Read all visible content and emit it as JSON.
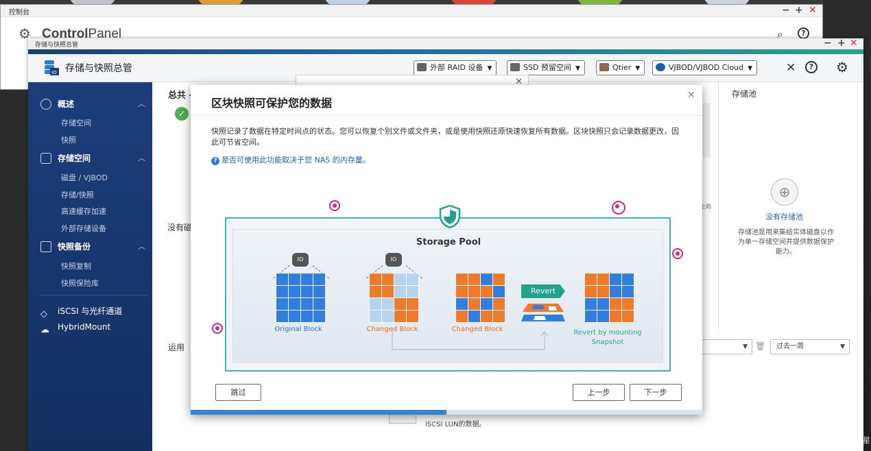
{
  "control_panel": {
    "title_bar": "控制台",
    "app_name_bold": "Control",
    "app_name_rest": "Panel",
    "minimize": "−",
    "maximize": "+",
    "close": "✕"
  },
  "storage_window": {
    "title_bar": "存储与快照总管",
    "app_name": "存储与快照总管",
    "minimize": "−",
    "maximize": "+",
    "close": "✕",
    "toolbar": {
      "external_raid": "外部 RAID 设备",
      "ssd_reserve": "SSD 预留空间",
      "qtier": "Qtier",
      "vjbod": "VJBOD/VJBOD Cloud"
    }
  },
  "sidebar": {
    "overview": {
      "label": "概述",
      "items": [
        "存储空间",
        "快照"
      ]
    },
    "storage": {
      "label": "存储空间",
      "items": [
        "磁盘 / VJBOD",
        "存储/快照",
        "高速缓存加速",
        "外部存储设备"
      ]
    },
    "snapshot_backup": {
      "label": "快照备份",
      "items": [
        "快照复制",
        "快照保险库"
      ]
    },
    "iscsi": "iSCSI 与光纤通道",
    "hybridmount": "HybridMount"
  },
  "main": {
    "total_label": "总共 -",
    "no_disk_label": "没有磁",
    "usage_label": "运用",
    "side_cut_text": "上的",
    "pool_header": "存储池",
    "pool_none": "没有存储池",
    "pool_desc": "存储池是用来集结实体磁盘以作为单一存储空间并提供数据保护能力。",
    "range_select": "过去一周",
    "bottom_text": "iSCSI LUN的数据。"
  },
  "dialog": {
    "title": "区块快照可保护您的数据",
    "description": "快照记录了数据在特定时间点的状态。您可以恢复个别文件或文件夹，或是使用快照还原快速恢复所有数据。区块快照只会记录数据更改，因此可节省空间。",
    "tip": "是否可使用此功能取决于您 NAS 的内存量。",
    "skip": "跳过",
    "prev": "上一步",
    "next": "下一步",
    "progress": 0.5,
    "illustration": {
      "title": "Storage Pool",
      "camera_label": "IO",
      "original": "Original Block",
      "changed1": "Changed Block",
      "changed2": "Changed Block",
      "revert": "Revert",
      "revert_caption_1": "Revert by mounting",
      "revert_caption_2": "Snapshot"
    }
  },
  "edge_text": "星",
  "colors": {
    "sidebar": "#1b3d7a",
    "accent_teal": "#3fb8a8",
    "block_blue": "#2f7fe0",
    "block_orange": "#ee7a2a",
    "close_red": "#e03030"
  }
}
